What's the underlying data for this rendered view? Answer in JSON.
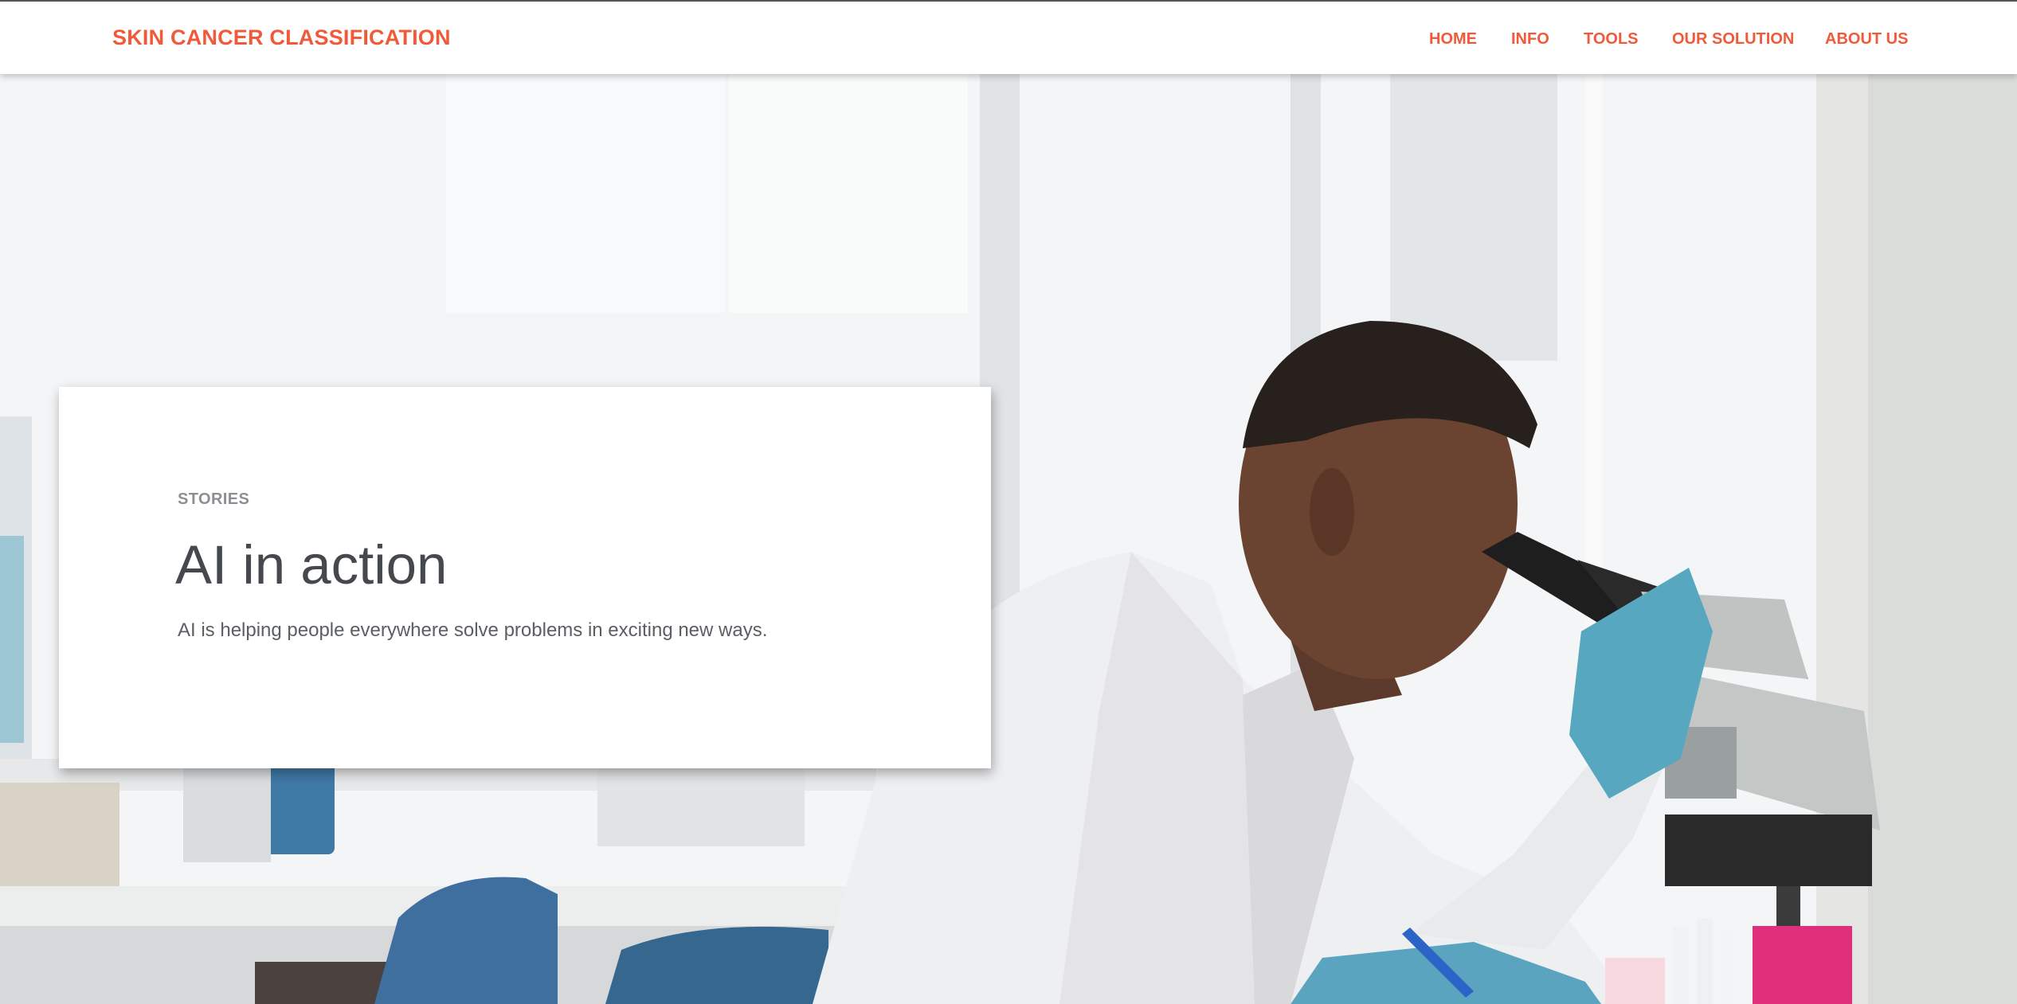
{
  "navbar": {
    "brand": "SKIN CANCER CLASSIFICATION",
    "links": [
      {
        "label": "HOME"
      },
      {
        "label": "INFO"
      },
      {
        "label": "TOOLS"
      },
      {
        "label": "OUR SOLUTION"
      },
      {
        "label": "ABOUT US"
      }
    ]
  },
  "hero": {
    "image_subject": "lab scientist looking into microscope",
    "card": {
      "eyebrow": "STORIES",
      "headline": "AI in action",
      "subtext": "AI is helping people everywhere solve problems in exciting new ways."
    }
  },
  "colors": {
    "accent": "#f05a3a",
    "headline": "#45484d",
    "eyebrow": "#8c8f94",
    "body_text": "#5b5e63",
    "background": "#ffffff"
  }
}
